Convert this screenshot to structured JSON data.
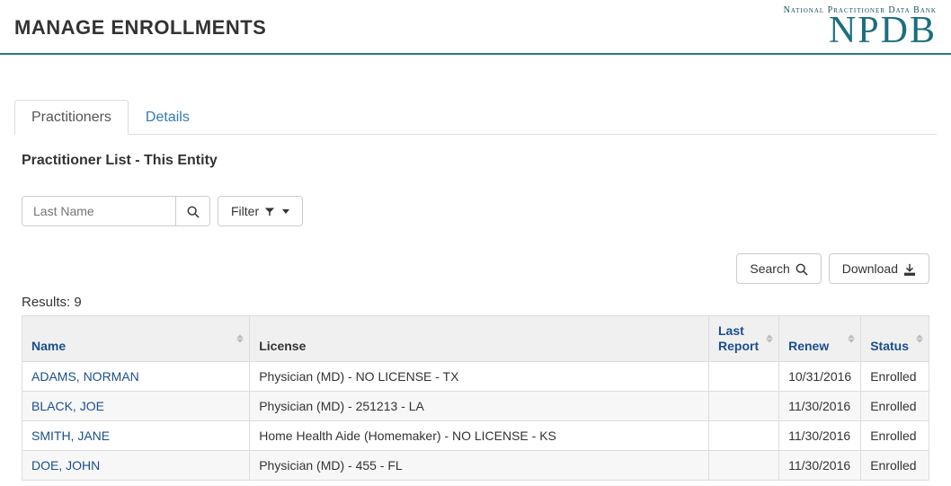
{
  "header": {
    "title": "MANAGE ENROLLMENTS",
    "logo_sub": "National Practitioner Data Bank",
    "logo_main": "NPDB"
  },
  "tabs": {
    "practitioners": "Practitioners",
    "details": "Details"
  },
  "section": {
    "title": "Practitioner List - This Entity"
  },
  "controls": {
    "lastname_placeholder": "Last Name",
    "filter_label": "Filter",
    "search_label": "Search",
    "download_label": "Download"
  },
  "table": {
    "results_prefix": "Results:",
    "results_count": "9",
    "columns": {
      "name": "Name",
      "license": "License",
      "last_report": "Last Report",
      "renew": "Renew",
      "status": "Status"
    },
    "rows": [
      {
        "name": "ADAMS, NORMAN",
        "license": "Physician (MD) - NO LICENSE - TX",
        "last_report": "",
        "renew": "10/31/2016",
        "status": "Enrolled"
      },
      {
        "name": "BLACK, JOE",
        "license": "Physician (MD) - 251213 - LA",
        "last_report": "",
        "renew": "11/30/2016",
        "status": "Enrolled"
      },
      {
        "name": "SMITH, JANE",
        "license": "Home Health Aide (Homemaker) - NO LICENSE - KS",
        "last_report": "",
        "renew": "11/30/2016",
        "status": "Enrolled"
      },
      {
        "name": "DOE, JOHN",
        "license": "Physician (MD) - 455 - FL",
        "last_report": "",
        "renew": "11/30/2016",
        "status": "Enrolled"
      }
    ]
  }
}
